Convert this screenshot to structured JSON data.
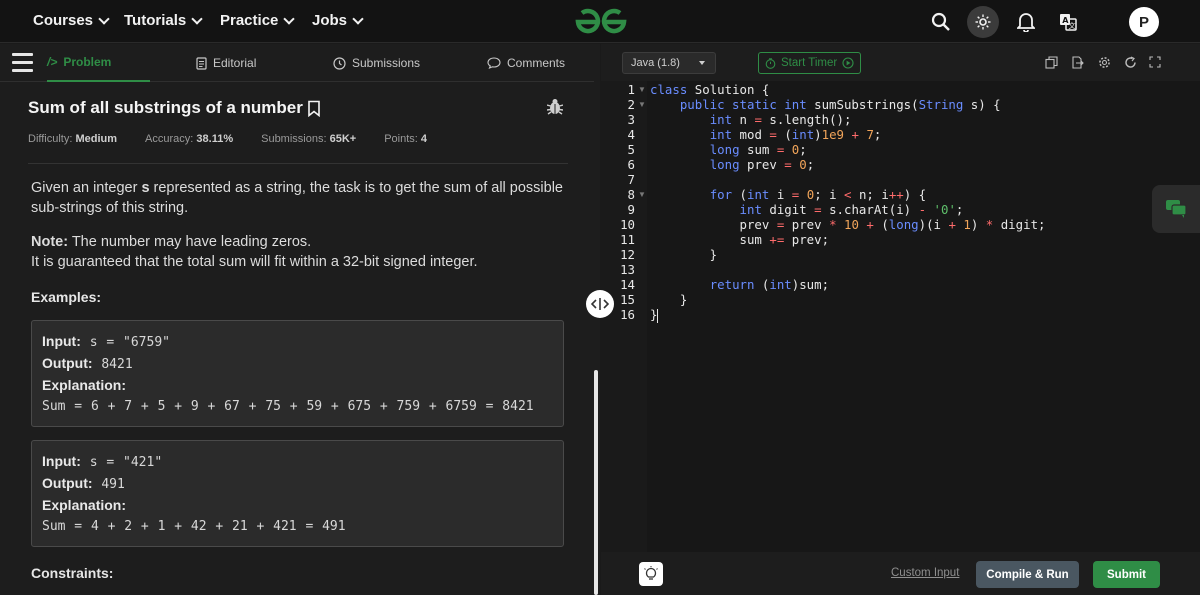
{
  "nav": {
    "items": [
      {
        "label": "Courses"
      },
      {
        "label": "Tutorials"
      },
      {
        "label": "Practice"
      },
      {
        "label": "Jobs"
      }
    ],
    "avatar_initial": "P",
    "icons": [
      "search-icon",
      "theme-toggle-icon",
      "notification-bell-icon",
      "translate-icon"
    ]
  },
  "tabs": [
    {
      "label": "Problem",
      "active": true
    },
    {
      "label": "Editorial"
    },
    {
      "label": "Submissions"
    },
    {
      "label": "Comments"
    }
  ],
  "problem": {
    "title": "Sum of all substrings of a number",
    "meta": {
      "difficulty_label": "Difficulty:",
      "difficulty": "Medium",
      "accuracy_label": "Accuracy:",
      "accuracy": "38.11%",
      "submissions_label": "Submissions:",
      "submissions": "65K+",
      "points_label": "Points:",
      "points": "4"
    },
    "statement_pre": "Given an integer ",
    "statement_var": "s",
    "statement_post": " represented as a string, the task is to get the sum of all possible sub-strings of this string.",
    "note_label": "Note:",
    "note_text": " The number may have leading zeros.",
    "guarantee": "It is guaranteed that the total sum will fit within a 32-bit signed integer.",
    "examples_label": "Examples:",
    "examples": [
      {
        "input_label": "Input:",
        "input": " s = \"6759\"",
        "output_label": "Output:",
        "output": " 8421",
        "explanation_label": "Explanation:",
        "explanation": "Sum = 6 + 7 + 5 + 9 + 67 + 75 + 59 + 675 + 759 + 6759 = 8421"
      },
      {
        "input_label": "Input:",
        "input": " s = \"421\"",
        "output_label": "Output:",
        "output": " 491",
        "explanation_label": "Explanation:",
        "explanation": "Sum = 4 + 2 + 1 + 42 + 21 + 421 = 491"
      }
    ],
    "constraints_label": "Constraints:"
  },
  "editor": {
    "language": "Java (1.8)",
    "timer_label": "Start Timer",
    "line_numbers": [
      "1",
      "2",
      "3",
      "4",
      "5",
      "6",
      "7",
      "8",
      "9",
      "10",
      "11",
      "12",
      "13",
      "14",
      "15",
      "16"
    ],
    "custom_input_label": "Custom Input",
    "compile_label": "Compile & Run",
    "submit_label": "Submit"
  },
  "colors": {
    "accent": "#2f8d46",
    "keyword": "#6a8dff",
    "operator": "#ff6b6b",
    "number": "#f2a55a",
    "string": "#5fc06b",
    "compile_bg": "#4a5761"
  }
}
